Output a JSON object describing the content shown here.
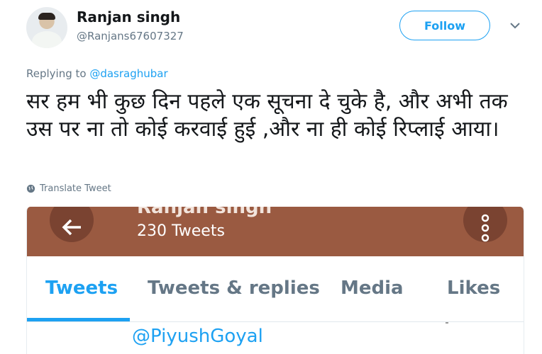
{
  "author": {
    "name": "Ranjan singh",
    "handle": "@Ranjans67607327"
  },
  "follow_label": "Follow",
  "reply": {
    "prefix": "Replying to ",
    "to": "@dasraghubar"
  },
  "tweet_text": "सर हम भी कुछ दिन पहले एक सूचना दे चुके है, और अभी तक उस पर ना तो कोई करवाई हुई ,और ना ही कोई रिप्लाई आया।",
  "translate_label": "Translate Tweet",
  "embedded_screenshot": {
    "profile_name": "Ranjan singh",
    "tweet_count": "230 Tweets",
    "tabs": [
      {
        "label": "Tweets",
        "active": true
      },
      {
        "label": "Tweets & replies",
        "active": false
      },
      {
        "label": "Media",
        "active": false
      },
      {
        "label": "Likes",
        "active": false
      }
    ],
    "mention": "@PiyushGoyal"
  },
  "colors": {
    "accent": "#1da1f2",
    "header_brown": "#9a5a41",
    "muted": "#657786"
  },
  "icons": [
    "chevron-down-icon",
    "globe-icon",
    "back-arrow-icon",
    "more-vertical-icon"
  ]
}
